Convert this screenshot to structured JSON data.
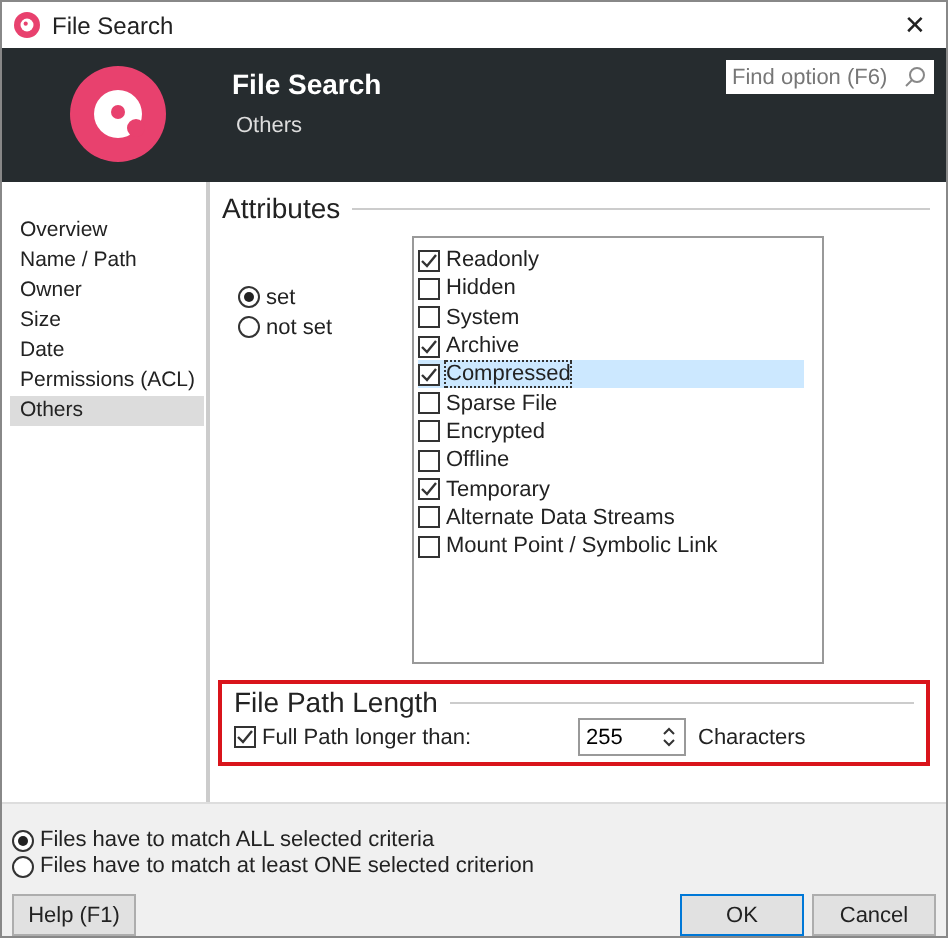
{
  "window": {
    "title": "File Search",
    "close": "✕"
  },
  "header": {
    "title": "File Search",
    "subtitle": "Others",
    "search": {
      "placeholder": "Find option (F6)"
    }
  },
  "sidebar": {
    "items": [
      {
        "label": "Overview",
        "selected": false
      },
      {
        "label": "Name / Path",
        "selected": false
      },
      {
        "label": "Owner",
        "selected": false
      },
      {
        "label": "Size",
        "selected": false
      },
      {
        "label": "Date",
        "selected": false
      },
      {
        "label": "Permissions (ACL)",
        "selected": false
      },
      {
        "label": "Others",
        "selected": true
      }
    ]
  },
  "attributes": {
    "title": "Attributes",
    "modes": [
      {
        "label": "set",
        "selected": true
      },
      {
        "label": "not set",
        "selected": false
      }
    ],
    "items": [
      {
        "label": "Readonly",
        "checked": true,
        "selected": false
      },
      {
        "label": "Hidden",
        "checked": false,
        "selected": false
      },
      {
        "label": "System",
        "checked": false,
        "selected": false
      },
      {
        "label": "Archive",
        "checked": true,
        "selected": false
      },
      {
        "label": "Compressed",
        "checked": true,
        "selected": true
      },
      {
        "label": "Sparse File",
        "checked": false,
        "selected": false
      },
      {
        "label": "Encrypted",
        "checked": false,
        "selected": false
      },
      {
        "label": "Offline",
        "checked": false,
        "selected": false
      },
      {
        "label": "Temporary",
        "checked": true,
        "selected": false
      },
      {
        "label": "Alternate Data Streams",
        "checked": false,
        "selected": false
      },
      {
        "label": "Mount Point / Symbolic Link",
        "checked": false,
        "selected": false
      }
    ]
  },
  "path_length": {
    "title": "File Path Length",
    "label": "Full Path longer than:",
    "checked": true,
    "value": "255",
    "unit": "Characters"
  },
  "match": [
    {
      "label": "Files have to match ALL selected criteria",
      "selected": true
    },
    {
      "label": "Files have to match at least ONE selected criterion",
      "selected": false
    }
  ],
  "buttons": [
    {
      "label": "Help (F1)",
      "kind": "help"
    },
    {
      "label": "OK",
      "kind": "default"
    },
    {
      "label": "Cancel",
      "kind": "normal"
    }
  ]
}
